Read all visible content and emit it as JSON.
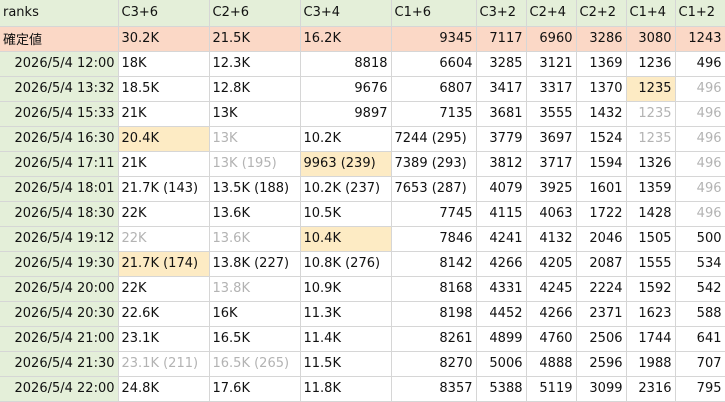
{
  "columns": [
    "ranks",
    "C3+6",
    "C2+6",
    "C3+4",
    "C1+6",
    "C3+2",
    "C2+4",
    "C2+2",
    "C1+4",
    "C1+2"
  ],
  "confirmed": {
    "label": "確定値",
    "values": [
      "30.2K",
      "21.5K",
      "16.2K",
      "9345",
      "7117",
      "6960",
      "3286",
      "3080",
      "1243"
    ]
  },
  "rows": [
    {
      "time": "2026/5/4 12:00",
      "cells": [
        {
          "v": "18K"
        },
        {
          "v": "12.3K"
        },
        {
          "v": "8818",
          "a": "r"
        },
        {
          "v": "6604",
          "a": "r"
        },
        {
          "v": "3285"
        },
        {
          "v": "3121"
        },
        {
          "v": "1369"
        },
        {
          "v": "1236"
        },
        {
          "v": "496"
        }
      ]
    },
    {
      "time": "2026/5/4 13:32",
      "cells": [
        {
          "v": "18.5K"
        },
        {
          "v": "12.8K"
        },
        {
          "v": "9676",
          "a": "r"
        },
        {
          "v": "6807",
          "a": "r"
        },
        {
          "v": "3417"
        },
        {
          "v": "3317"
        },
        {
          "v": "1370"
        },
        {
          "v": "1235",
          "hl": true
        },
        {
          "v": "496",
          "g": true
        }
      ]
    },
    {
      "time": "2026/5/4 15:33",
      "cells": [
        {
          "v": "21K"
        },
        {
          "v": "13K"
        },
        {
          "v": "9897",
          "a": "r"
        },
        {
          "v": "7135",
          "a": "r"
        },
        {
          "v": "3681"
        },
        {
          "v": "3555"
        },
        {
          "v": "1432"
        },
        {
          "v": "1235",
          "g": true
        },
        {
          "v": "496",
          "g": true
        }
      ]
    },
    {
      "time": "2026/5/4 16:30",
      "cells": [
        {
          "v": "20.4K",
          "hl": true
        },
        {
          "v": "13K",
          "g": true
        },
        {
          "v": "10.2K"
        },
        {
          "v": "7244 (295)",
          "a": "l"
        },
        {
          "v": "3779"
        },
        {
          "v": "3697"
        },
        {
          "v": "1524"
        },
        {
          "v": "1235",
          "g": true
        },
        {
          "v": "496",
          "g": true
        }
      ]
    },
    {
      "time": "2026/5/4 17:11",
      "cells": [
        {
          "v": "21K"
        },
        {
          "v": "13K (195)",
          "g": true
        },
        {
          "v": "9963 (239)",
          "hl": true
        },
        {
          "v": "7389 (293)",
          "a": "l"
        },
        {
          "v": "3812"
        },
        {
          "v": "3717"
        },
        {
          "v": "1594"
        },
        {
          "v": "1326"
        },
        {
          "v": "496",
          "g": true
        }
      ]
    },
    {
      "time": "2026/5/4 18:01",
      "cells": [
        {
          "v": "21.7K (143)"
        },
        {
          "v": "13.5K (188)"
        },
        {
          "v": "10.2K (237)"
        },
        {
          "v": "7653 (287)",
          "a": "l"
        },
        {
          "v": "4079"
        },
        {
          "v": "3925"
        },
        {
          "v": "1601"
        },
        {
          "v": "1359"
        },
        {
          "v": "496",
          "g": true
        }
      ]
    },
    {
      "time": "2026/5/4 18:30",
      "cells": [
        {
          "v": "22K"
        },
        {
          "v": "13.6K"
        },
        {
          "v": "10.5K"
        },
        {
          "v": "7745",
          "a": "r"
        },
        {
          "v": "4115"
        },
        {
          "v": "4063"
        },
        {
          "v": "1722"
        },
        {
          "v": "1428"
        },
        {
          "v": "496",
          "g": true
        }
      ]
    },
    {
      "time": "2026/5/4 19:12",
      "cells": [
        {
          "v": "22K",
          "g": true
        },
        {
          "v": "13.6K",
          "g": true
        },
        {
          "v": "10.4K",
          "hl": true
        },
        {
          "v": "7846",
          "a": "r"
        },
        {
          "v": "4241"
        },
        {
          "v": "4132"
        },
        {
          "v": "2046"
        },
        {
          "v": "1505"
        },
        {
          "v": "500"
        }
      ]
    },
    {
      "time": "2026/5/4 19:30",
      "cells": [
        {
          "v": "21.7K (174)",
          "hl": true
        },
        {
          "v": "13.8K (227)"
        },
        {
          "v": "10.8K (276)"
        },
        {
          "v": "8142",
          "a": "r"
        },
        {
          "v": "4266"
        },
        {
          "v": "4205"
        },
        {
          "v": "2087"
        },
        {
          "v": "1555"
        },
        {
          "v": "534"
        }
      ]
    },
    {
      "time": "2026/5/4 20:00",
      "cells": [
        {
          "v": "22K"
        },
        {
          "v": "13.8K",
          "g": true
        },
        {
          "v": "10.9K"
        },
        {
          "v": "8168",
          "a": "r"
        },
        {
          "v": "4331"
        },
        {
          "v": "4245"
        },
        {
          "v": "2224"
        },
        {
          "v": "1592"
        },
        {
          "v": "542"
        }
      ]
    },
    {
      "time": "2026/5/4 20:30",
      "cells": [
        {
          "v": "22.6K"
        },
        {
          "v": "16K"
        },
        {
          "v": "11.3K"
        },
        {
          "v": "8198",
          "a": "r"
        },
        {
          "v": "4452"
        },
        {
          "v": "4266"
        },
        {
          "v": "2371"
        },
        {
          "v": "1623"
        },
        {
          "v": "588"
        }
      ]
    },
    {
      "time": "2026/5/4 21:00",
      "cells": [
        {
          "v": "23.1K"
        },
        {
          "v": "16.5K"
        },
        {
          "v": "11.4K"
        },
        {
          "v": "8261",
          "a": "r"
        },
        {
          "v": "4899"
        },
        {
          "v": "4760"
        },
        {
          "v": "2506"
        },
        {
          "v": "1744"
        },
        {
          "v": "641"
        }
      ]
    },
    {
      "time": "2026/5/4 21:30",
      "cells": [
        {
          "v": "23.1K (211)",
          "g": true
        },
        {
          "v": "16.5K (265)",
          "g": true
        },
        {
          "v": "11.5K"
        },
        {
          "v": "8270",
          "a": "r"
        },
        {
          "v": "5006"
        },
        {
          "v": "4888"
        },
        {
          "v": "2596"
        },
        {
          "v": "1988"
        },
        {
          "v": "707"
        }
      ]
    },
    {
      "time": "2026/5/4 22:00",
      "cells": [
        {
          "v": "24.8K"
        },
        {
          "v": "17.6K"
        },
        {
          "v": "11.8K"
        },
        {
          "v": "8357",
          "a": "r"
        },
        {
          "v": "5388"
        },
        {
          "v": "5119"
        },
        {
          "v": "3099"
        },
        {
          "v": "2316"
        },
        {
          "v": "795"
        }
      ]
    }
  ]
}
